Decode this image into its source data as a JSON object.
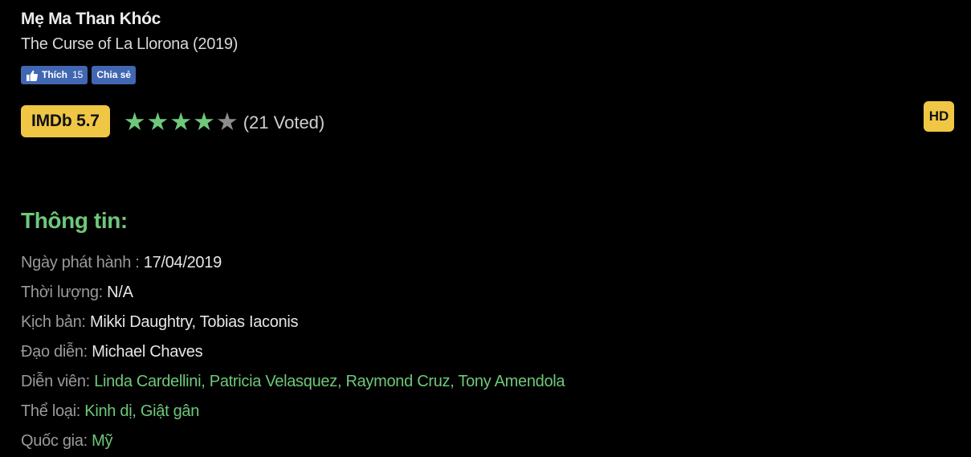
{
  "movie": {
    "title_vi": "Mẹ Ma Than Khóc",
    "title_en": "The Curse of La Llorona (2019)"
  },
  "facebook": {
    "like_label": "Thích",
    "like_count": "15",
    "share_label": "Chia sẻ",
    "like_color": "#4267b2"
  },
  "rating": {
    "imdb_label": "IMDb 5.7",
    "stars_filled": 4,
    "stars_total": 5,
    "voted_text": "(21 Voted)",
    "badge_color": "#f0c645",
    "star_color": "#6ec87a"
  },
  "quality_badge": "HD",
  "info": {
    "heading": "Thông tin:",
    "release_label": "Ngày phát hành : ",
    "release_value": "17/04/2019",
    "duration_label": "Thời lượng: ",
    "duration_value": "N/A",
    "writer_label": "Kịch bản: ",
    "writer_value": "Mikki Daughtry, Tobias Iaconis",
    "director_label": "Đạo diễn: ",
    "director_value": "Michael Chaves",
    "cast_label": "Diễn viên: ",
    "cast": [
      "Linda Cardellini",
      "Patricia Velasquez",
      "Raymond Cruz",
      "Tony Amendola"
    ],
    "genre_label": "Thể loại: ",
    "genres": [
      "Kinh dị",
      "Giật gân"
    ],
    "country_label": "Quốc gia: ",
    "country_value": "Mỹ"
  }
}
